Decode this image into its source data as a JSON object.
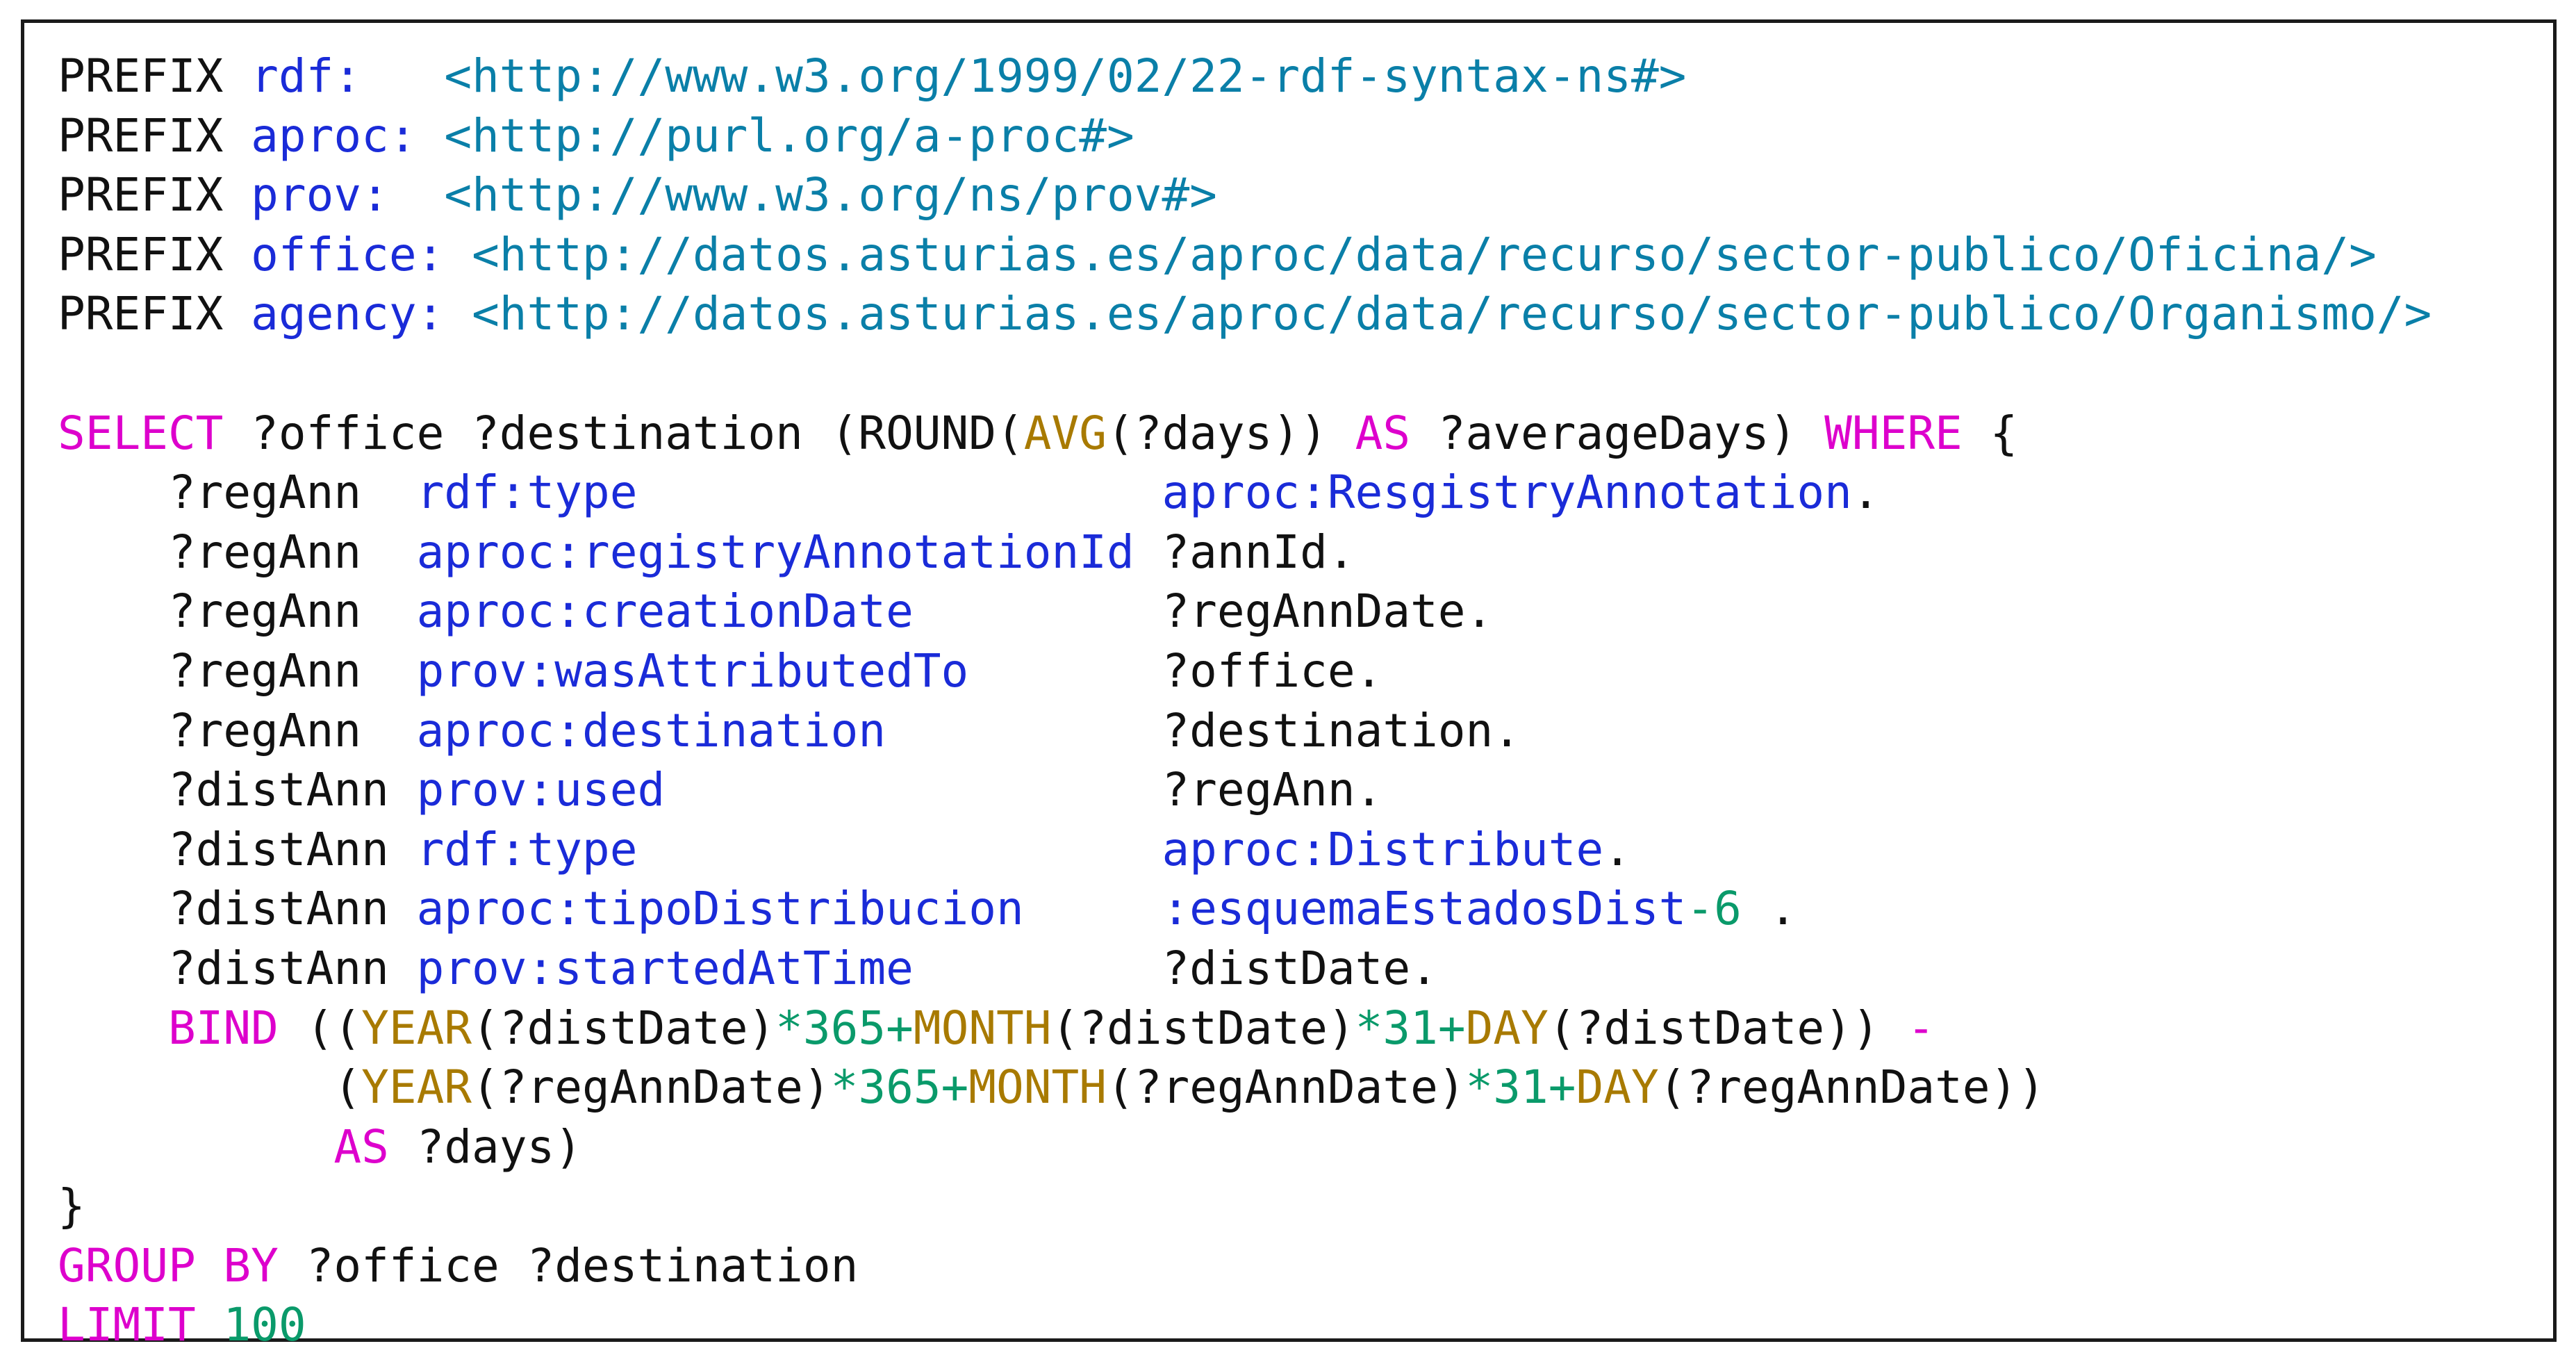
{
  "colors": {
    "keyword": "#dd00cc",
    "namespace_term": "#1a2bd8",
    "iri": "#0a7fa8",
    "function": "#a87a00",
    "number_operator": "#0a9a6a",
    "plain": "#111111",
    "border": "#1a1a1a"
  },
  "code": {
    "lines": [
      {
        "tokens": [
          {
            "t": "PREFIX ",
            "c": "plain"
          },
          {
            "t": "rdf:",
            "c": "ns"
          },
          {
            "t": "   ",
            "c": "plain"
          },
          {
            "t": "<http://www.w3.org/1999/02/22-rdf-syntax-ns#>",
            "c": "iri"
          }
        ]
      },
      {
        "tokens": [
          {
            "t": "PREFIX ",
            "c": "plain"
          },
          {
            "t": "aproc:",
            "c": "ns"
          },
          {
            "t": " ",
            "c": "plain"
          },
          {
            "t": "<http://purl.org/a-proc#>",
            "c": "iri"
          }
        ]
      },
      {
        "tokens": [
          {
            "t": "PREFIX ",
            "c": "plain"
          },
          {
            "t": "prov:",
            "c": "ns"
          },
          {
            "t": "  ",
            "c": "plain"
          },
          {
            "t": "<http://www.w3.org/ns/prov#>",
            "c": "iri"
          }
        ]
      },
      {
        "tokens": [
          {
            "t": "PREFIX ",
            "c": "plain"
          },
          {
            "t": "office:",
            "c": "ns"
          },
          {
            "t": " ",
            "c": "plain"
          },
          {
            "t": "<http://datos.asturias.es/aproc/data/recurso/sector-publico/Oficina/>",
            "c": "iri"
          }
        ]
      },
      {
        "tokens": [
          {
            "t": "PREFIX ",
            "c": "plain"
          },
          {
            "t": "agency:",
            "c": "ns"
          },
          {
            "t": " ",
            "c": "plain"
          },
          {
            "t": "<http://datos.asturias.es/aproc/data/recurso/sector-publico/Organismo/>",
            "c": "iri"
          }
        ]
      },
      {
        "tokens": []
      },
      {
        "tokens": [
          {
            "t": "SELECT",
            "c": "kw"
          },
          {
            "t": " ?office ?destination (ROUND(",
            "c": "plain"
          },
          {
            "t": "AVG",
            "c": "fn"
          },
          {
            "t": "(?days)) ",
            "c": "plain"
          },
          {
            "t": "AS",
            "c": "kw"
          },
          {
            "t": " ?averageDays) ",
            "c": "plain"
          },
          {
            "t": "WHERE",
            "c": "kw"
          },
          {
            "t": " {",
            "c": "plain"
          }
        ]
      },
      {
        "tokens": [
          {
            "t": "    ?regAnn  ",
            "c": "plain"
          },
          {
            "t": "rdf:type",
            "c": "ns"
          },
          {
            "t": "                   ",
            "c": "plain"
          },
          {
            "t": "aproc:ResgistryAnnotation",
            "c": "ns"
          },
          {
            "t": ".",
            "c": "plain"
          }
        ]
      },
      {
        "tokens": [
          {
            "t": "    ?regAnn  ",
            "c": "plain"
          },
          {
            "t": "aproc:registryAnnotationId",
            "c": "ns"
          },
          {
            "t": " ?annId.",
            "c": "plain"
          }
        ]
      },
      {
        "tokens": [
          {
            "t": "    ?regAnn  ",
            "c": "plain"
          },
          {
            "t": "aproc:creationDate",
            "c": "ns"
          },
          {
            "t": "         ?regAnnDate.",
            "c": "plain"
          }
        ]
      },
      {
        "tokens": [
          {
            "t": "    ?regAnn  ",
            "c": "plain"
          },
          {
            "t": "prov:wasAttributedTo",
            "c": "ns"
          },
          {
            "t": "       ?office.",
            "c": "plain"
          }
        ]
      },
      {
        "tokens": [
          {
            "t": "    ?regAnn  ",
            "c": "plain"
          },
          {
            "t": "aproc:destination",
            "c": "ns"
          },
          {
            "t": "          ?destination.",
            "c": "plain"
          }
        ]
      },
      {
        "tokens": [
          {
            "t": "    ?distAnn ",
            "c": "plain"
          },
          {
            "t": "prov:used",
            "c": "ns"
          },
          {
            "t": "                  ?regAnn.",
            "c": "plain"
          }
        ]
      },
      {
        "tokens": [
          {
            "t": "    ?distAnn ",
            "c": "plain"
          },
          {
            "t": "rdf:type",
            "c": "ns"
          },
          {
            "t": "                   ",
            "c": "plain"
          },
          {
            "t": "aproc:Distribute",
            "c": "ns"
          },
          {
            "t": ".",
            "c": "plain"
          }
        ]
      },
      {
        "tokens": [
          {
            "t": "    ?distAnn ",
            "c": "plain"
          },
          {
            "t": "aproc:tipoDistribucion",
            "c": "ns"
          },
          {
            "t": "     ",
            "c": "plain"
          },
          {
            "t": ":esquemaEstadosDist",
            "c": "ns"
          },
          {
            "t": "-6",
            "c": "num"
          },
          {
            "t": " .",
            "c": "plain"
          }
        ]
      },
      {
        "tokens": [
          {
            "t": "    ?distAnn ",
            "c": "plain"
          },
          {
            "t": "prov:startedAtTime",
            "c": "ns"
          },
          {
            "t": "         ?distDate.",
            "c": "plain"
          }
        ]
      },
      {
        "tokens": [
          {
            "t": "    ",
            "c": "plain"
          },
          {
            "t": "BIND",
            "c": "kw"
          },
          {
            "t": " ((",
            "c": "plain"
          },
          {
            "t": "YEAR",
            "c": "fn"
          },
          {
            "t": "(?distDate)",
            "c": "plain"
          },
          {
            "t": "*365+",
            "c": "num"
          },
          {
            "t": "MONTH",
            "c": "fn"
          },
          {
            "t": "(?distDate)",
            "c": "plain"
          },
          {
            "t": "*31+",
            "c": "num"
          },
          {
            "t": "DAY",
            "c": "fn"
          },
          {
            "t": "(?distDate)) ",
            "c": "plain"
          },
          {
            "t": "-",
            "c": "kw"
          }
        ]
      },
      {
        "tokens": [
          {
            "t": "          (",
            "c": "plain"
          },
          {
            "t": "YEAR",
            "c": "fn"
          },
          {
            "t": "(?regAnnDate)",
            "c": "plain"
          },
          {
            "t": "*365+",
            "c": "num"
          },
          {
            "t": "MONTH",
            "c": "fn"
          },
          {
            "t": "(?regAnnDate)",
            "c": "plain"
          },
          {
            "t": "*31+",
            "c": "num"
          },
          {
            "t": "DAY",
            "c": "fn"
          },
          {
            "t": "(?regAnnDate))",
            "c": "plain"
          }
        ]
      },
      {
        "tokens": [
          {
            "t": "          ",
            "c": "plain"
          },
          {
            "t": "AS",
            "c": "kw"
          },
          {
            "t": " ?days)",
            "c": "plain"
          }
        ]
      },
      {
        "tokens": [
          {
            "t": "}",
            "c": "plain"
          }
        ]
      },
      {
        "tokens": [
          {
            "t": "GROUP BY",
            "c": "kw"
          },
          {
            "t": " ?office ?destination",
            "c": "plain"
          }
        ]
      },
      {
        "tokens": [
          {
            "t": "LIMIT",
            "c": "kw"
          },
          {
            "t": " ",
            "c": "plain"
          },
          {
            "t": "100",
            "c": "num"
          }
        ]
      }
    ]
  }
}
